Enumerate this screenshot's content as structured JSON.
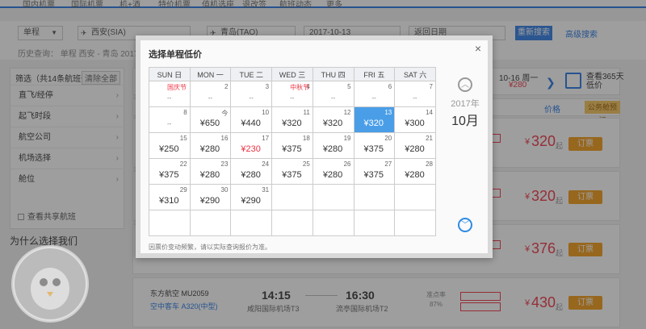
{
  "topnav": {
    "items": [
      "国内机票",
      "国际机票",
      "机+酒",
      "特价机票",
      "值机选座",
      "退改签",
      "航班动态",
      "更多"
    ]
  },
  "search": {
    "trip_type": "单程",
    "from_city": "西安(SIA)",
    "to_city": "青岛(TAO)",
    "date": "2017-10-13",
    "return_placeholder": "返回日期",
    "search_button": "重新搜索",
    "advanced": "高级搜索"
  },
  "history": "历史查询：  单程 西安 - 青岛  2017-10-13",
  "sidebar": {
    "title": "筛选（共14条航班信息）",
    "clear": "清除全部",
    "items": [
      "直飞/经停",
      "起飞时段",
      "航空公司",
      "机场选择",
      "舱位"
    ],
    "checkbox": "查看共享航班",
    "why_title": "为什么选择我们"
  },
  "datestrip": {
    "day": "10-16 周一",
    "price": "¥280",
    "cal_label_1": "查看365天",
    "cal_label_2": "低价"
  },
  "sortbar": {
    "price_label": "价格",
    "biz_btn": "公务舱预订"
  },
  "rows": [
    {
      "price": "320",
      "unit": "起",
      "book": "订票"
    },
    {
      "price": "320",
      "unit": "起",
      "book": "订票"
    },
    {
      "price": "376",
      "unit": "起",
      "book": "订票"
    },
    {
      "price": "430",
      "unit": "起",
      "book": "订票"
    }
  ],
  "flight": {
    "airline": "东方航空 MU2059",
    "model": "空中客车 A320(中型)",
    "dep_time": "14:15",
    "dep_airport": "咸阳国际机场T3",
    "arr_time": "16:30",
    "arr_airport": "流亭国际机场T2",
    "ontime_label": "准点率",
    "ontime_value": "87%"
  },
  "modal": {
    "title": "选择单程低价",
    "close": "×",
    "weekdays": [
      "SUN 日",
      "MON 一",
      "TUE 二",
      "WED 三",
      "THU 四",
      "FRI 五",
      "SAT 六"
    ],
    "year": "2017年",
    "month": "10月",
    "note": "因票价变动频繁，请以实际查询报价为准。",
    "weeks": [
      [
        {
          "d": "",
          "p": "",
          "h": "国庆节",
          "dash": "--"
        },
        {
          "d": "2",
          "p": "",
          "dash": "--"
        },
        {
          "d": "3",
          "p": "",
          "dash": "--"
        },
        {
          "d": "4",
          "p": "",
          "h": "中秋节",
          "dash": "--"
        },
        {
          "d": "5",
          "p": "",
          "dash": "--"
        },
        {
          "d": "6",
          "p": "",
          "dash": "--"
        },
        {
          "d": "7",
          "p": "",
          "dash": "--"
        }
      ],
      [
        {
          "d": "8",
          "p": "",
          "dash": "--"
        },
        {
          "d": "今",
          "p": "¥650"
        },
        {
          "d": "10",
          "p": "¥440"
        },
        {
          "d": "11",
          "p": "¥320"
        },
        {
          "d": "12",
          "p": "¥320"
        },
        {
          "d": "13",
          "p": "¥320",
          "sel": true
        },
        {
          "d": "14",
          "p": "¥300"
        }
      ],
      [
        {
          "d": "15",
          "p": "¥250"
        },
        {
          "d": "16",
          "p": "¥280"
        },
        {
          "d": "17",
          "p": "¥230",
          "low": true
        },
        {
          "d": "18",
          "p": "¥375"
        },
        {
          "d": "19",
          "p": "¥280"
        },
        {
          "d": "20",
          "p": "¥375"
        },
        {
          "d": "21",
          "p": "¥280"
        }
      ],
      [
        {
          "d": "22",
          "p": "¥375"
        },
        {
          "d": "23",
          "p": "¥280"
        },
        {
          "d": "24",
          "p": "¥280"
        },
        {
          "d": "25",
          "p": "¥375"
        },
        {
          "d": "26",
          "p": "¥280"
        },
        {
          "d": "27",
          "p": "¥375"
        },
        {
          "d": "28",
          "p": "¥280"
        }
      ],
      [
        {
          "d": "29",
          "p": "¥310"
        },
        {
          "d": "30",
          "p": "¥290"
        },
        {
          "d": "31",
          "p": "¥290"
        },
        {
          "d": "",
          "p": ""
        },
        {
          "d": "",
          "p": ""
        },
        {
          "d": "",
          "p": ""
        },
        {
          "d": "",
          "p": ""
        }
      ],
      [
        {
          "d": "",
          "p": ""
        },
        {
          "d": "",
          "p": ""
        },
        {
          "d": "",
          "p": ""
        },
        {
          "d": "",
          "p": ""
        },
        {
          "d": "",
          "p": ""
        },
        {
          "d": "",
          "p": ""
        },
        {
          "d": "",
          "p": ""
        }
      ]
    ]
  },
  "colors": {
    "accent": "#2f7ce6",
    "selected": "#4a9ee8",
    "price_red": "#ee3344",
    "book_orange": "#f29b17"
  }
}
